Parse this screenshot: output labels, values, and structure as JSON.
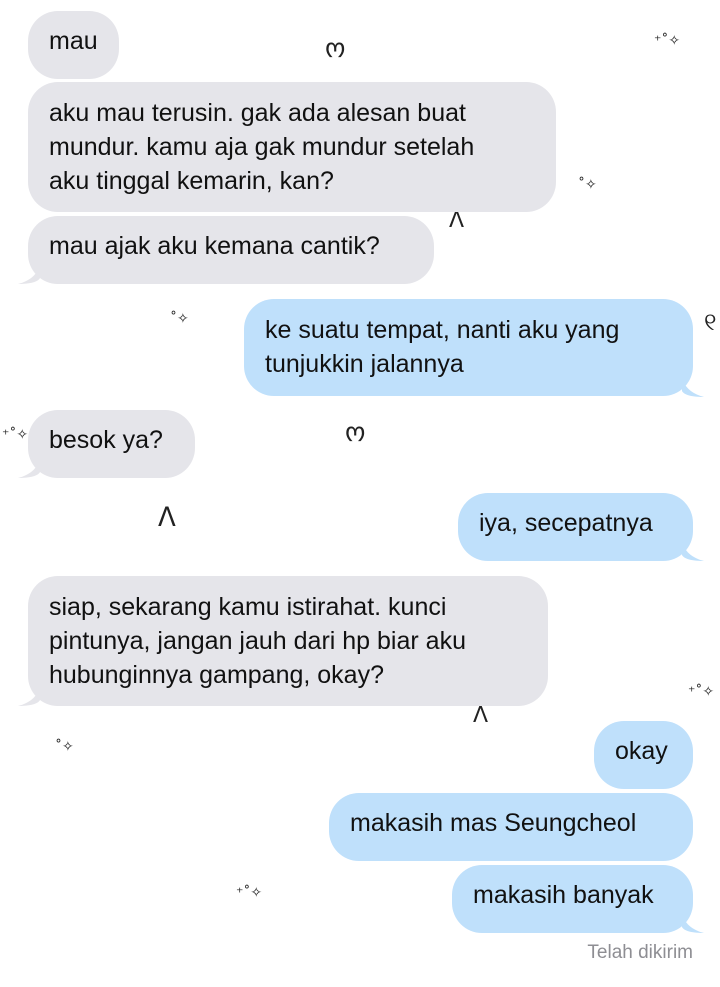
{
  "colors": {
    "incoming_bubble": "#e5e5ea",
    "outgoing_bubble": "#bfe0fb",
    "text": "#111111",
    "status_text": "#8e8e93"
  },
  "messages": [
    {
      "direction": "incoming",
      "text": "mau"
    },
    {
      "direction": "incoming",
      "text": "aku mau terusin. gak ada alesan buat\nmundur. kamu aja gak mundur setelah\naku tinggal kemarin, kan?"
    },
    {
      "direction": "incoming",
      "text": "mau ajak aku kemana cantik?"
    },
    {
      "direction": "outgoing",
      "text": "ke suatu tempat, nanti aku yang\ntunjukkin jalannya"
    },
    {
      "direction": "incoming",
      "text": "besok ya?"
    },
    {
      "direction": "outgoing",
      "text": "iya, secepatnya"
    },
    {
      "direction": "incoming",
      "text": "siap, sekarang kamu istirahat. kunci\npintunya, jangan jauh dari hp biar aku\nhubunginnya gampang, okay?"
    },
    {
      "direction": "outgoing",
      "text": "okay"
    },
    {
      "direction": "outgoing",
      "text": "makasih mas Seungcheol"
    },
    {
      "direction": "outgoing",
      "text": "makasih banyak"
    }
  ],
  "status": "Telah dikirim",
  "decorations": [
    "sparkle-icon",
    "heart-doodle-icon",
    "arch-doodle-icon",
    "bow-doodle-icon"
  ]
}
